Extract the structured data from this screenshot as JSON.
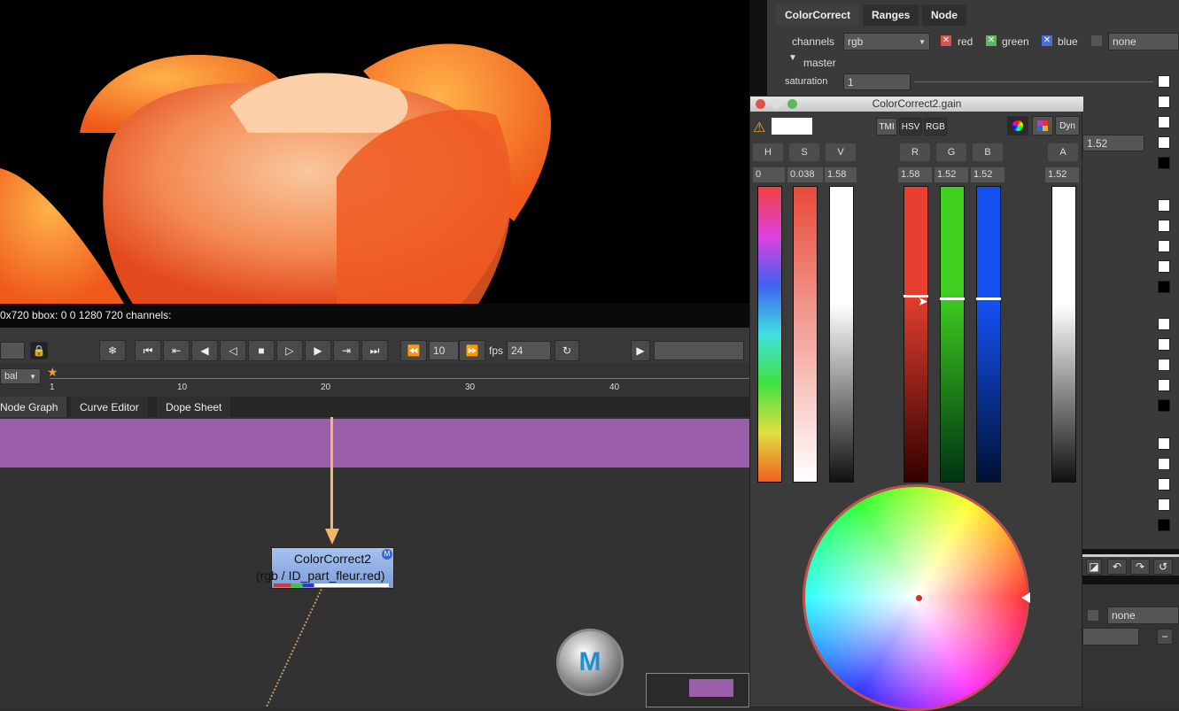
{
  "viewer": {
    "info": "0x720 bbox: 0 0 1280 720 channels:"
  },
  "playback": {
    "frame_increment": "10",
    "fps_label": "fps",
    "fps": "24",
    "view_mode": "bal"
  },
  "timeline": {
    "ticks": [
      "1",
      "10",
      "20",
      "30",
      "40"
    ]
  },
  "panel_tabs": [
    "Node Graph",
    "Curve Editor",
    "Dope Sheet"
  ],
  "node": {
    "name": "ColorCorrect2",
    "subtitle": "(rgb / ID_part_fleur.red)",
    "badge": "M"
  },
  "properties": {
    "tabs": [
      "ColorCorrect",
      "Ranges",
      "Node"
    ],
    "channels_label": "channels",
    "channels_value": "rgb",
    "channel_toggles": [
      {
        "label": "red",
        "color": "#d9534f"
      },
      {
        "label": "green",
        "color": "#5cb85c"
      },
      {
        "label": "blue",
        "color": "#4a6fd9"
      }
    ],
    "mask_value": "none",
    "master_label": "master",
    "saturation_label": "saturation",
    "saturation_value": "1",
    "gain_value": "1.52",
    "bottom_none": "none"
  },
  "color_picker": {
    "title": "ColorCorrect2.gain",
    "modes": [
      "TMI",
      "HSV",
      "RGB"
    ],
    "dyn_label": "Dyn",
    "channels": [
      {
        "label": "H",
        "value": "0"
      },
      {
        "label": "S",
        "value": "0.038"
      },
      {
        "label": "V",
        "value": "1.58"
      },
      {
        "label": "R",
        "value": "1.58"
      },
      {
        "label": "G",
        "value": "1.52"
      },
      {
        "label": "B",
        "value": "1.52"
      },
      {
        "label": "A",
        "value": "1.52"
      }
    ]
  },
  "colors": {
    "backdrop": "#9b5ea8",
    "node": "#8fb0e8",
    "arrow": "#f2b76a"
  }
}
